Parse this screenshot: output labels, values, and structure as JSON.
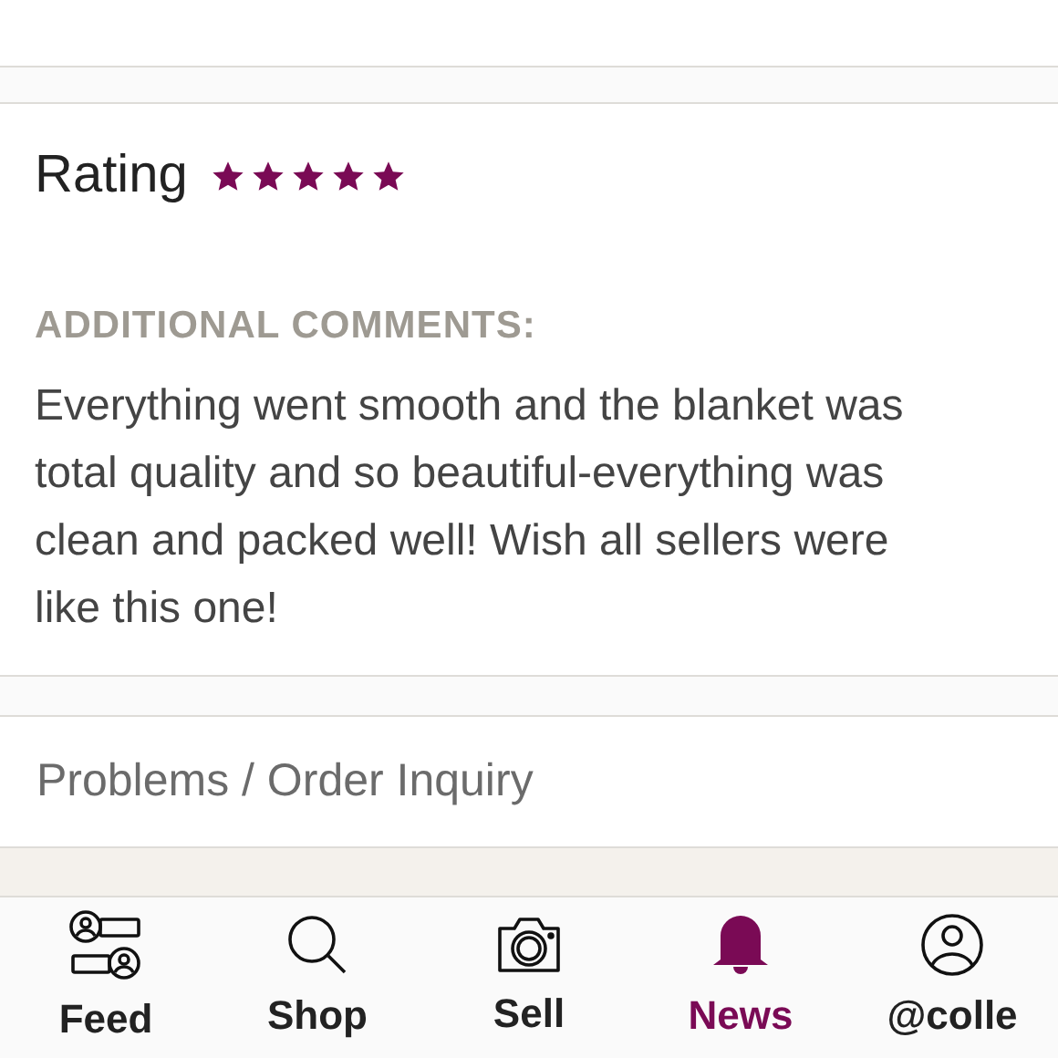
{
  "rating": {
    "label": "Rating",
    "stars": 5
  },
  "comments": {
    "heading": "ADDITIONAL COMMENTS:",
    "text": "Everything went smooth and the blanket was total quality and so beautiful-everything was clean and packed well! Wish all sellers were like this one!"
  },
  "inquiry": {
    "label": "Problems / Order Inquiry"
  },
  "nav": [
    {
      "kind": "feed",
      "label": "Feed",
      "selected": false
    },
    {
      "kind": "shop",
      "label": "Shop",
      "selected": false
    },
    {
      "kind": "sell",
      "label": "Sell",
      "selected": false
    },
    {
      "kind": "news",
      "label": "News",
      "selected": true
    },
    {
      "kind": "profile",
      "label": "@colle",
      "selected": false
    }
  ]
}
